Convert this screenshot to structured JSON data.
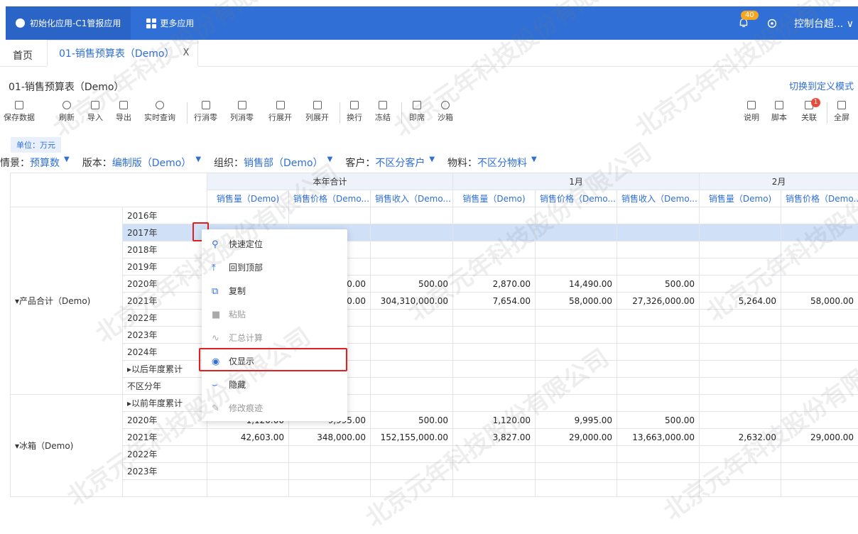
{
  "topbar": {
    "app_tab": "初始化应用-C1管报应用",
    "more_apps": "更多应用",
    "notification_count": "40",
    "console": "控制台超... ∨"
  },
  "tabs": {
    "home": "首页",
    "active": "01-销售预算表（Demo）",
    "close": "X"
  },
  "report": {
    "title": "01-销售预算表（Demo）",
    "switch_mode": "切换到定义模式",
    "unit": "单位：万元"
  },
  "toolbar": {
    "save": "保存数据",
    "refresh": "刷新",
    "import": "导入",
    "export": "导出",
    "realtime": "实时查询",
    "row_zero": "行消零",
    "col_zero": "列消零",
    "row_expand": "行展开",
    "col_expand": "列展开",
    "wrap": "换行",
    "freeze": "冻结",
    "instant": "即席",
    "sandbox": "沙箱",
    "desc": "说明",
    "script": "脚本",
    "relate": "关联",
    "relate_badge": "1",
    "fullscreen": "全屏"
  },
  "filters": [
    {
      "label": "情景：",
      "value": "预算数"
    },
    {
      "label": "版本：",
      "value": "编制版（Demo）"
    },
    {
      "label": "组织：",
      "value": "销售部（Demo）"
    },
    {
      "label": "客户：",
      "value": "不区分客户"
    },
    {
      "label": "物料：",
      "value": "不区分物料"
    }
  ],
  "table": {
    "groups": [
      "本年合计",
      "1月",
      "2月"
    ],
    "measures": [
      "销售量（Demo)",
      "销售价格（Demo...",
      "销售收入（Demo...",
      "销售量（Demo)",
      "销售价格（Demo...",
      "销售收入（Demo...",
      "销售量（Demo)",
      "销售价格（Demo..."
    ],
    "group1_label": "▾产品合计（Demo)",
    "group2_label": "▾冰箱（Demo)",
    "rows1": [
      {
        "year": "2016年",
        "cells": [
          "",
          "",
          "",
          "",
          "",
          "",
          "",
          ""
        ]
      },
      {
        "year": "2017年",
        "cells": [
          "",
          "",
          "",
          "",
          "",
          "",
          "",
          ""
        ]
      },
      {
        "year": "2018年",
        "cells": [
          "",
          "",
          "",
          "",
          "",
          "",
          "",
          ""
        ]
      },
      {
        "year": "2019年",
        "cells": [
          "",
          "",
          "",
          "",
          "",
          "",
          "",
          ""
        ]
      },
      {
        "year": "2020年",
        "cells": [
          "",
          "),90.00",
          "500.00",
          "2,870.00",
          "14,490.00",
          "500.00",
          "",
          ""
        ]
      },
      {
        "year": "2021年",
        "cells": [
          "",
          "),00.00",
          "304,310,000.00",
          "7,654.00",
          "58,000.00",
          "27,326,000.00",
          "5,264.00",
          "58,000.00"
        ]
      },
      {
        "year": "2022年",
        "cells": [
          "",
          "",
          "",
          "",
          "",
          "",
          "",
          ""
        ]
      },
      {
        "year": "2023年",
        "cells": [
          "",
          "",
          "",
          "",
          "",
          "",
          "",
          ""
        ]
      },
      {
        "year": "2024年",
        "cells": [
          "",
          "",
          "",
          "",
          "",
          "",
          "",
          ""
        ]
      },
      {
        "year": "▸以后年度累计",
        "cells": [
          "",
          "",
          "",
          "",
          "",
          "",
          "",
          ""
        ]
      },
      {
        "year": "不区分年",
        "cells": [
          "",
          "",
          "",
          "",
          "",
          "",
          "",
          ""
        ]
      }
    ],
    "rows2": [
      {
        "year": "▸以前年度累计",
        "cells": [
          "",
          "",
          "",
          "",
          "",
          "",
          "",
          ""
        ]
      },
      {
        "year": "2020年",
        "cells": [
          "1,120.00",
          "9,995.00",
          "500.00",
          "1,120.00",
          "9,995.00",
          "500.00",
          "",
          ""
        ]
      },
      {
        "year": "2021年",
        "cells": [
          "42,603.00",
          "348,000.00",
          "152,155,000.00",
          "3,827.00",
          "29,000.00",
          "13,663,000.00",
          "2,632.00",
          "29,000.00"
        ]
      },
      {
        "year": "2022年",
        "cells": [
          "",
          "",
          "",
          "",
          "",
          "",
          "",
          ""
        ]
      },
      {
        "year": "2023年",
        "cells": [
          "",
          "",
          "",
          "",
          "",
          "",
          "",
          ""
        ]
      }
    ]
  },
  "context_menu": [
    {
      "label": "快速定位",
      "icon": "locate-icon",
      "disabled": false
    },
    {
      "label": "回到顶部",
      "icon": "to-top-icon",
      "disabled": false
    },
    {
      "label": "复制",
      "icon": "copy-icon",
      "disabled": false
    },
    {
      "label": "粘贴",
      "icon": "paste-icon",
      "disabled": true
    },
    {
      "label": "汇总计算",
      "icon": "sum-icon",
      "disabled": true
    },
    {
      "label": "仅显示",
      "icon": "eye-icon",
      "disabled": false
    },
    {
      "label": "隐藏",
      "icon": "hide-icon",
      "disabled": false
    },
    {
      "label": "修改痕迹",
      "icon": "edit-trace-icon",
      "disabled": true
    }
  ],
  "watermark": "北京元年科技股份有限公司",
  "colors": {
    "brand": "#2f6fd6",
    "highlight": "#e02020",
    "selected_row": "#cfe0f7"
  }
}
